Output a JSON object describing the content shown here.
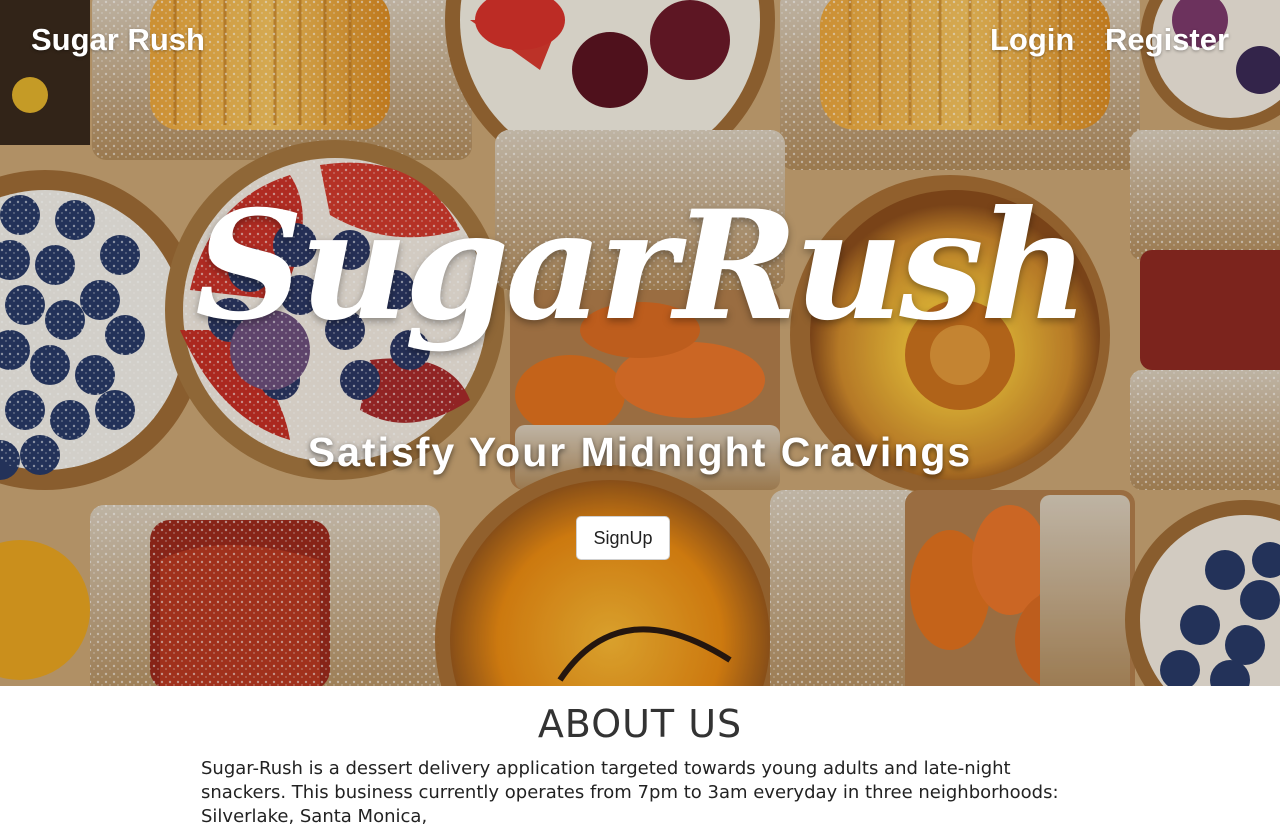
{
  "nav": {
    "brand": "Sugar Rush",
    "login": "Login",
    "register": "Register"
  },
  "hero": {
    "logo_text": "SugarRush",
    "tagline": "Satisfy Your Midnight Cravings",
    "signup_label": "SignUp"
  },
  "about": {
    "heading": "ABOUT US",
    "text": "Sugar-Rush is a dessert delivery application targeted towards young adults and late-night snackers. This business currently operates from 7pm to 3am everyday in three neighborhoods: Silverlake, Santa Monica,"
  },
  "colors": {
    "nav_text": "#ffffff",
    "button_bg": "#ffffff",
    "heading": "#333333",
    "body_text": "#222222"
  }
}
